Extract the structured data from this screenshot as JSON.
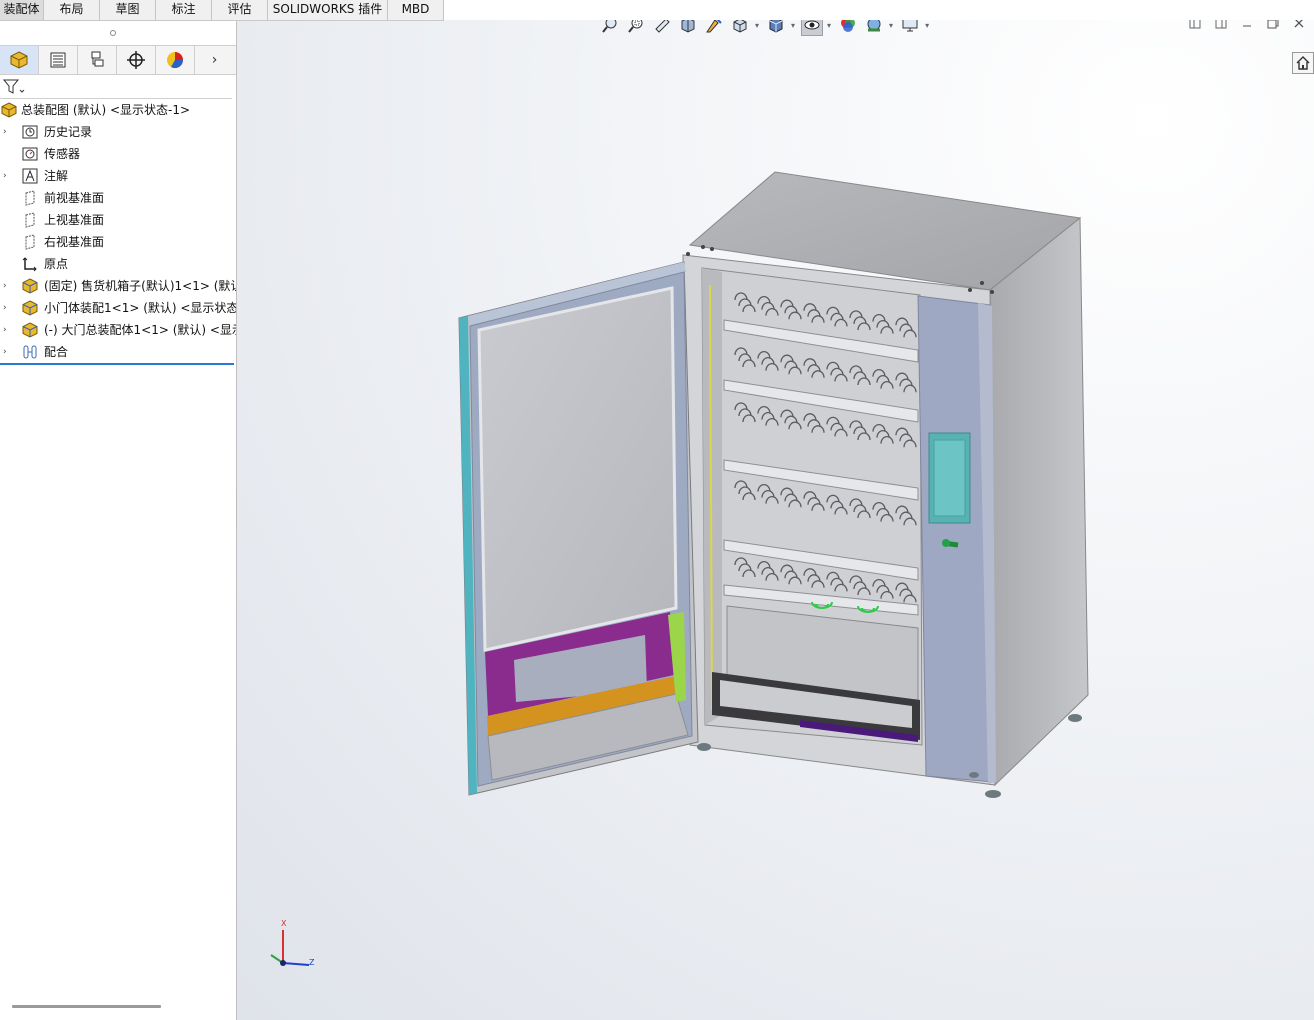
{
  "tabs": [
    {
      "label": "装配体",
      "w": 44,
      "active": true
    },
    {
      "label": "布局",
      "w": 56
    },
    {
      "label": "草图",
      "w": 56
    },
    {
      "label": "标注",
      "w": 56
    },
    {
      "label": "评估",
      "w": 56
    },
    {
      "label": "SOLIDWORKS 插件",
      "w": 120
    },
    {
      "label": "MBD",
      "w": 56
    }
  ],
  "panel_tabs": [
    "featuremanager-tree",
    "property-manager",
    "configuration-manager",
    "dimxpert-manager",
    "display-manager"
  ],
  "tree": {
    "root": "总装配图 (默认) <显示状态-1>",
    "items": [
      {
        "label": "历史记录",
        "icon": "history-icon",
        "expand": true
      },
      {
        "label": "传感器",
        "icon": "sensor-icon",
        "expand": false
      },
      {
        "label": "注解",
        "icon": "annotation-icon",
        "expand": true
      },
      {
        "label": "前视基准面",
        "icon": "plane-icon",
        "expand": false
      },
      {
        "label": "上视基准面",
        "icon": "plane-icon",
        "expand": false
      },
      {
        "label": "右视基准面",
        "icon": "plane-icon",
        "expand": false
      },
      {
        "label": "原点",
        "icon": "origin-icon",
        "expand": false
      },
      {
        "label": "(固定) 售货机箱子(默认)1<1> (默认",
        "icon": "subassembly-icon",
        "expand": true
      },
      {
        "label": "小门体装配1<1> (默认) <显示状态",
        "icon": "subassembly-icon",
        "expand": true
      },
      {
        "label": "(-) 大门总装配体1<1> (默认) <显示",
        "icon": "subassembly-icon",
        "expand": true
      },
      {
        "label": "配合",
        "icon": "mates-icon",
        "expand": true
      }
    ]
  },
  "triad": {
    "x": "X",
    "z": "Z"
  }
}
